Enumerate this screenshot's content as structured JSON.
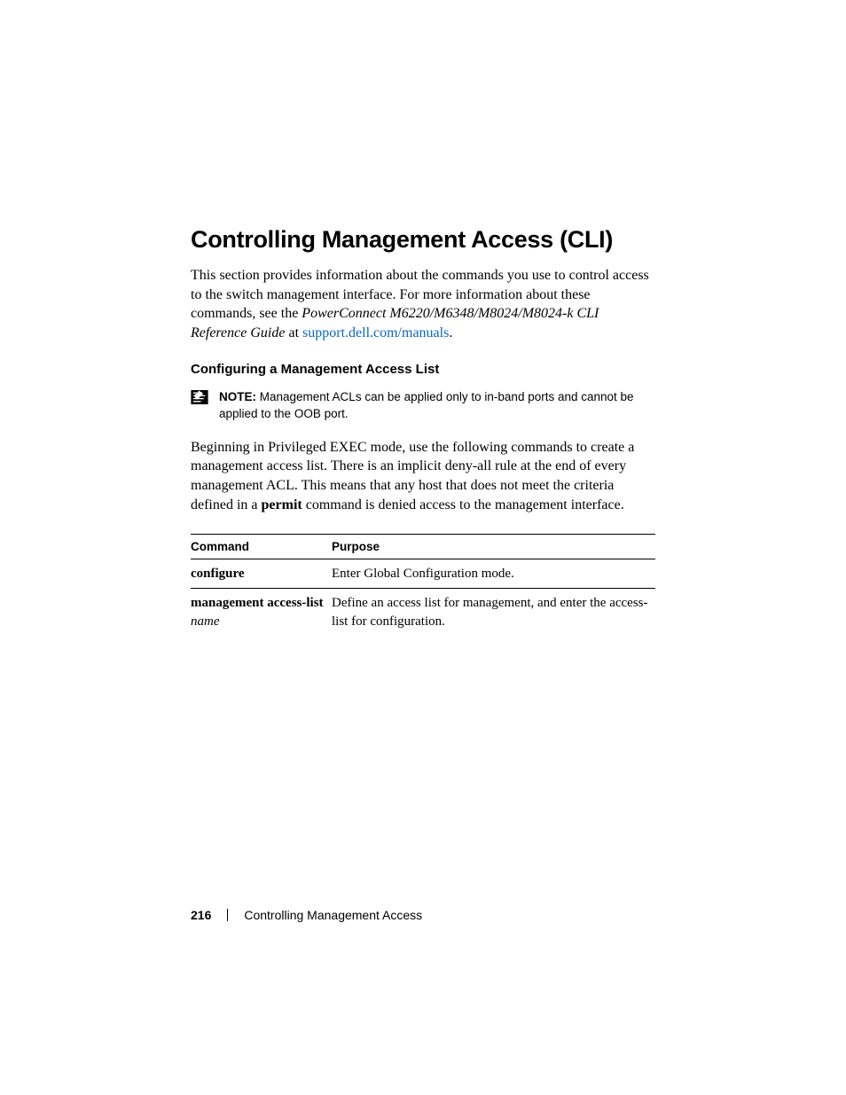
{
  "heading": "Controlling Management Access (CLI)",
  "intro": {
    "pre": "This section provides information about the commands you use to control access to the switch management interface. For more information about these commands, see the ",
    "doc_title": "PowerConnect M6220/M6348/M8024/M8024-k CLI Reference Guide",
    "at": " at ",
    "link": "support.dell.com/manuals",
    "period": "."
  },
  "subheading": "Configuring a Management Access List",
  "note": {
    "label": "NOTE:",
    "text": " Management ACLs can be applied only to in-band ports and cannot be applied to the OOB port."
  },
  "paragraph": {
    "pre": "Beginning in Privileged EXEC mode, use the following commands to create a management access list. There is an implicit deny-all rule at the end of every management ACL. This means that any host that does not meet the criteria defined in a ",
    "bold": "permit",
    "post": " command is denied access to the management interface."
  },
  "table": {
    "headers": {
      "cmd": "Command",
      "purpose": "Purpose"
    },
    "rows": [
      {
        "cmd_bold": "configure",
        "cmd_ital": "",
        "purpose": "Enter Global Configuration mode."
      },
      {
        "cmd_bold": "management access-list",
        "cmd_ital": "name",
        "purpose": "Define an access list for management, and enter the access-list for configuration."
      }
    ]
  },
  "footer": {
    "page": "216",
    "section": "Controlling Management Access"
  }
}
